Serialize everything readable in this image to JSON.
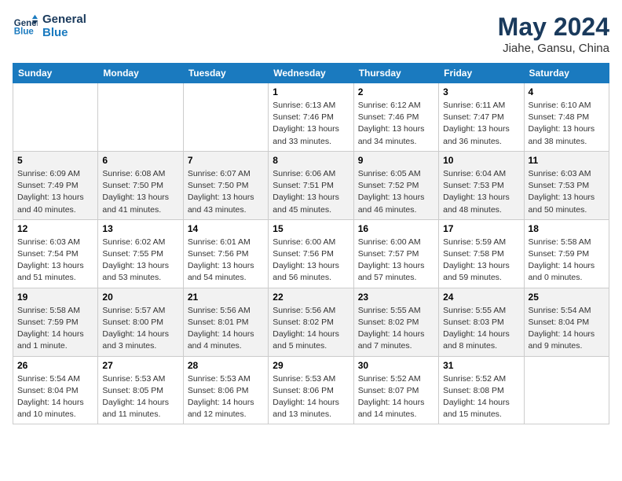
{
  "header": {
    "logo_line1": "General",
    "logo_line2": "Blue",
    "month_year": "May 2024",
    "location": "Jiahe, Gansu, China"
  },
  "days_of_week": [
    "Sunday",
    "Monday",
    "Tuesday",
    "Wednesday",
    "Thursday",
    "Friday",
    "Saturday"
  ],
  "weeks": [
    [
      {
        "num": "",
        "info": ""
      },
      {
        "num": "",
        "info": ""
      },
      {
        "num": "",
        "info": ""
      },
      {
        "num": "1",
        "info": "Sunrise: 6:13 AM\nSunset: 7:46 PM\nDaylight: 13 hours\nand 33 minutes."
      },
      {
        "num": "2",
        "info": "Sunrise: 6:12 AM\nSunset: 7:46 PM\nDaylight: 13 hours\nand 34 minutes."
      },
      {
        "num": "3",
        "info": "Sunrise: 6:11 AM\nSunset: 7:47 PM\nDaylight: 13 hours\nand 36 minutes."
      },
      {
        "num": "4",
        "info": "Sunrise: 6:10 AM\nSunset: 7:48 PM\nDaylight: 13 hours\nand 38 minutes."
      }
    ],
    [
      {
        "num": "5",
        "info": "Sunrise: 6:09 AM\nSunset: 7:49 PM\nDaylight: 13 hours\nand 40 minutes."
      },
      {
        "num": "6",
        "info": "Sunrise: 6:08 AM\nSunset: 7:50 PM\nDaylight: 13 hours\nand 41 minutes."
      },
      {
        "num": "7",
        "info": "Sunrise: 6:07 AM\nSunset: 7:50 PM\nDaylight: 13 hours\nand 43 minutes."
      },
      {
        "num": "8",
        "info": "Sunrise: 6:06 AM\nSunset: 7:51 PM\nDaylight: 13 hours\nand 45 minutes."
      },
      {
        "num": "9",
        "info": "Sunrise: 6:05 AM\nSunset: 7:52 PM\nDaylight: 13 hours\nand 46 minutes."
      },
      {
        "num": "10",
        "info": "Sunrise: 6:04 AM\nSunset: 7:53 PM\nDaylight: 13 hours\nand 48 minutes."
      },
      {
        "num": "11",
        "info": "Sunrise: 6:03 AM\nSunset: 7:53 PM\nDaylight: 13 hours\nand 50 minutes."
      }
    ],
    [
      {
        "num": "12",
        "info": "Sunrise: 6:03 AM\nSunset: 7:54 PM\nDaylight: 13 hours\nand 51 minutes."
      },
      {
        "num": "13",
        "info": "Sunrise: 6:02 AM\nSunset: 7:55 PM\nDaylight: 13 hours\nand 53 minutes."
      },
      {
        "num": "14",
        "info": "Sunrise: 6:01 AM\nSunset: 7:56 PM\nDaylight: 13 hours\nand 54 minutes."
      },
      {
        "num": "15",
        "info": "Sunrise: 6:00 AM\nSunset: 7:56 PM\nDaylight: 13 hours\nand 56 minutes."
      },
      {
        "num": "16",
        "info": "Sunrise: 6:00 AM\nSunset: 7:57 PM\nDaylight: 13 hours\nand 57 minutes."
      },
      {
        "num": "17",
        "info": "Sunrise: 5:59 AM\nSunset: 7:58 PM\nDaylight: 13 hours\nand 59 minutes."
      },
      {
        "num": "18",
        "info": "Sunrise: 5:58 AM\nSunset: 7:59 PM\nDaylight: 14 hours\nand 0 minutes."
      }
    ],
    [
      {
        "num": "19",
        "info": "Sunrise: 5:58 AM\nSunset: 7:59 PM\nDaylight: 14 hours\nand 1 minute."
      },
      {
        "num": "20",
        "info": "Sunrise: 5:57 AM\nSunset: 8:00 PM\nDaylight: 14 hours\nand 3 minutes."
      },
      {
        "num": "21",
        "info": "Sunrise: 5:56 AM\nSunset: 8:01 PM\nDaylight: 14 hours\nand 4 minutes."
      },
      {
        "num": "22",
        "info": "Sunrise: 5:56 AM\nSunset: 8:02 PM\nDaylight: 14 hours\nand 5 minutes."
      },
      {
        "num": "23",
        "info": "Sunrise: 5:55 AM\nSunset: 8:02 PM\nDaylight: 14 hours\nand 7 minutes."
      },
      {
        "num": "24",
        "info": "Sunrise: 5:55 AM\nSunset: 8:03 PM\nDaylight: 14 hours\nand 8 minutes."
      },
      {
        "num": "25",
        "info": "Sunrise: 5:54 AM\nSunset: 8:04 PM\nDaylight: 14 hours\nand 9 minutes."
      }
    ],
    [
      {
        "num": "26",
        "info": "Sunrise: 5:54 AM\nSunset: 8:04 PM\nDaylight: 14 hours\nand 10 minutes."
      },
      {
        "num": "27",
        "info": "Sunrise: 5:53 AM\nSunset: 8:05 PM\nDaylight: 14 hours\nand 11 minutes."
      },
      {
        "num": "28",
        "info": "Sunrise: 5:53 AM\nSunset: 8:06 PM\nDaylight: 14 hours\nand 12 minutes."
      },
      {
        "num": "29",
        "info": "Sunrise: 5:53 AM\nSunset: 8:06 PM\nDaylight: 14 hours\nand 13 minutes."
      },
      {
        "num": "30",
        "info": "Sunrise: 5:52 AM\nSunset: 8:07 PM\nDaylight: 14 hours\nand 14 minutes."
      },
      {
        "num": "31",
        "info": "Sunrise: 5:52 AM\nSunset: 8:08 PM\nDaylight: 14 hours\nand 15 minutes."
      },
      {
        "num": "",
        "info": ""
      }
    ]
  ]
}
